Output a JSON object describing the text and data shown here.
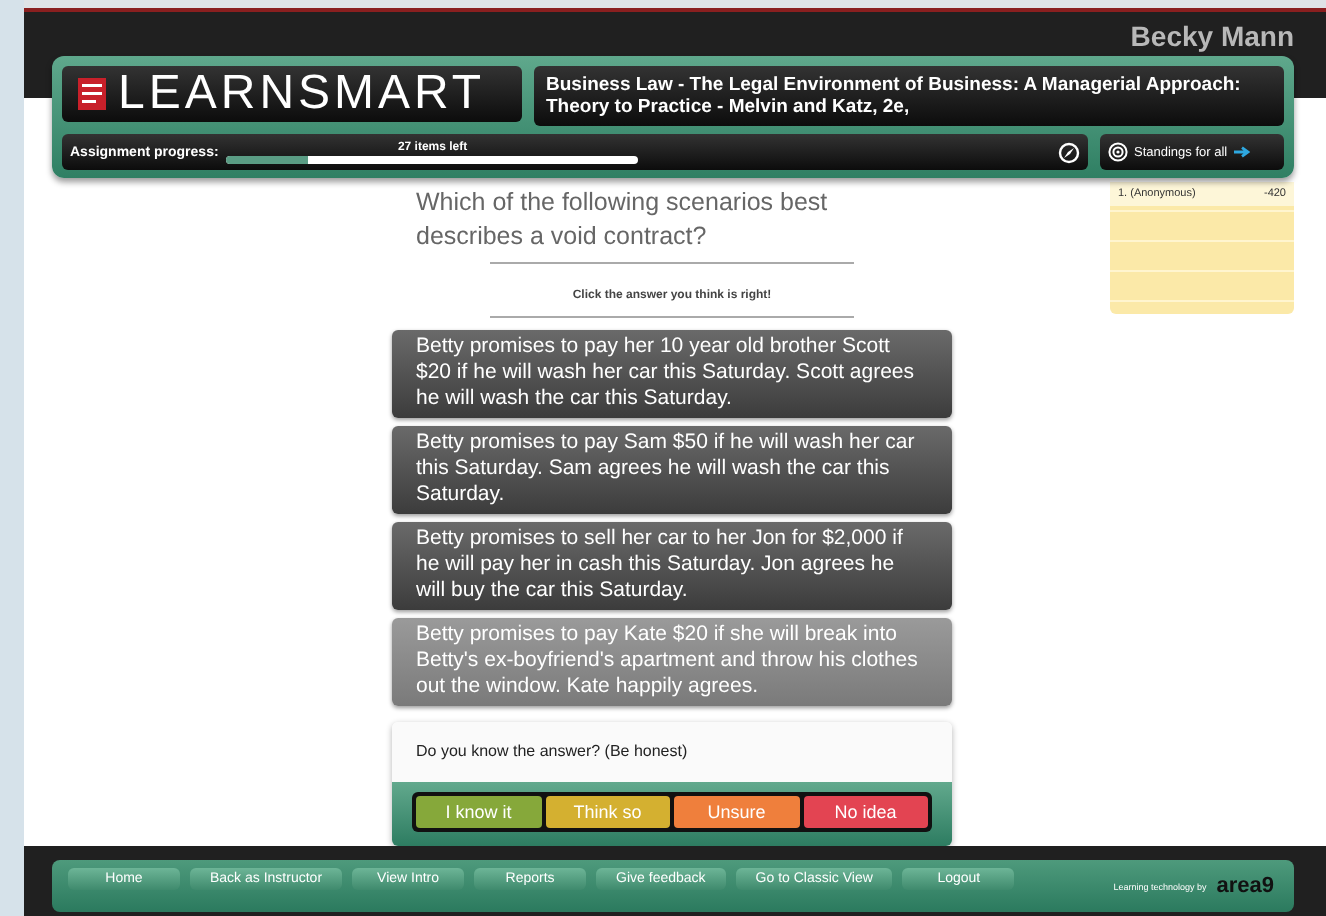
{
  "user": {
    "name": "Becky Mann"
  },
  "header": {
    "logo": "LEARNSMART",
    "course_title": "Business Law - The Legal Environment of Business: A Managerial Approach: Theory to Practice - Melvin and Katz, 2e,"
  },
  "progress": {
    "label": "Assignment progress:",
    "items_left": "27 items left",
    "level": 0.2
  },
  "standings": {
    "title": "Standings for all",
    "rows": [
      {
        "name": "1. (Anonymous)",
        "score": "-420"
      }
    ]
  },
  "question": {
    "text": "Which of the following scenarios best describes a void contract?",
    "instruction": "Click the answer you think is right!"
  },
  "answers": [
    {
      "text": "Betty promises to pay her 10 year old brother Scott $20 if he will wash her car this Saturday. Scott agrees he will wash the car this Saturday.",
      "highlighted": false
    },
    {
      "text": "Betty promises to pay Sam $50 if he will wash her car this Saturday. Sam agrees he will wash the car this Saturday.",
      "highlighted": false
    },
    {
      "text": "Betty promises to sell her car to her Jon for $2,000 if he will pay her in cash this Saturday. Jon agrees he will buy the car this Saturday.",
      "highlighted": false
    },
    {
      "text": "Betty promises to pay Kate $20 if she will break into Betty's ex-boyfriend's apartment and throw his clothes out the window. Kate happily agrees.",
      "highlighted": true
    }
  ],
  "confidence": {
    "prompt": "Do you know the answer? (Be honest)",
    "buttons": [
      {
        "label": "I know it",
        "color": "#86a83a"
      },
      {
        "label": "Think so",
        "color": "#d4b030"
      },
      {
        "label": "Unsure",
        "color": "#ef7f3c"
      },
      {
        "label": "No idea",
        "color": "#e34452"
      }
    ]
  },
  "footer": {
    "buttons": [
      "Home",
      "Back as Instructor",
      "View Intro",
      "Reports",
      "Give feedback",
      "Go to Classic View",
      "Logout"
    ],
    "credit": "Learning technology by",
    "brand": "area9"
  }
}
